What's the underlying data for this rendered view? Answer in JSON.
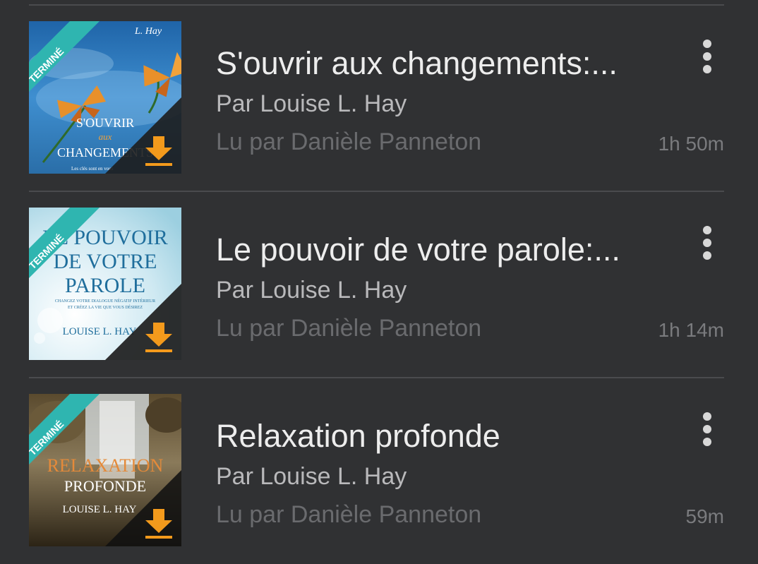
{
  "books": [
    {
      "title": "S'ouvrir aux changements:...",
      "author": "Par Louise L. Hay",
      "narrator": "Lu par Danièle Panneton",
      "duration": "1h 50m",
      "badge": "TERMINÉ",
      "cover": {
        "line1": "S'OUVRIR",
        "line2": "aux",
        "line3": "CHANGEMENTS",
        "footer": "Les clés sont en vous",
        "top": "L. Hay",
        "theme": "sky-butterflies"
      },
      "download_icon": "download-icon",
      "menu_icon": "more-vert-icon"
    },
    {
      "title": "Le pouvoir de votre parole:...",
      "author": "Par Louise L. Hay",
      "narrator": "Lu par Danièle Panneton",
      "duration": "1h 14m",
      "badge": "TERMINÉ",
      "cover": {
        "line1": "LE POUVOIR",
        "line2": "DE VOTRE",
        "line3": "PAROLE",
        "sub1": "CHANGEZ VOTRE DIALOGUE NÉGATIF INTÉRIEUR",
        "sub2": "ET CRÉEZ LA VIE QUE VOUS DÉSIREZ",
        "author": "LOUISE L. HAY",
        "theme": "light-blue"
      },
      "download_icon": "download-icon",
      "menu_icon": "more-vert-icon"
    },
    {
      "title": "Relaxation profonde",
      "author": "Par Louise L. Hay",
      "narrator": "Lu par Danièle Panneton",
      "duration": "59m",
      "badge": "TERMINÉ",
      "cover": {
        "line1": "RELAXATION",
        "line2": "PROFONDE",
        "author": "LOUISE L. HAY",
        "theme": "waterfall"
      },
      "download_icon": "download-icon",
      "menu_icon": "more-vert-icon"
    }
  ],
  "colors": {
    "background": "#303133",
    "badge": "#2fb5b0",
    "download": "#f39a1c",
    "title": "#ededed",
    "author": "#b9b9bb",
    "narrator": "#6a6b6e"
  }
}
